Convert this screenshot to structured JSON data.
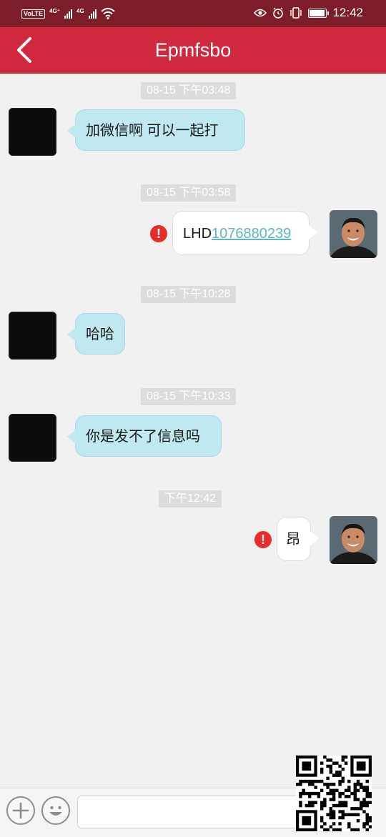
{
  "status_bar": {
    "volte": "VoLTE",
    "net1": "4G⁺",
    "net2": "4G",
    "time": "12:42"
  },
  "header": {
    "title": "Epmfsbo",
    "back_icon": "chevron-left-icon"
  },
  "messages": [
    {
      "time": "08-15 下午03:48",
      "direction": "in",
      "text": "加微信啊  可以一起打"
    },
    {
      "time": "08-15 下午03:58",
      "direction": "out",
      "text_prefix": "LHD",
      "link": "1076880239",
      "failed": true
    },
    {
      "time": "08-15 下午10:28",
      "direction": "in",
      "text": "哈哈"
    },
    {
      "time": "08-15 下午10:33",
      "direction": "in",
      "text": "你是发不了信息吗"
    },
    {
      "time": "下午12:42",
      "direction": "out",
      "text": "昂",
      "failed": true
    }
  ],
  "failed_mark": "!",
  "input_bar": {
    "add_icon": "plus-icon",
    "emoji_icon": "smiley-icon",
    "input_value": ""
  },
  "colors": {
    "header": "#d0283c",
    "status_bar": "#7e1d2a",
    "incoming_bubble": "#bfe8f0",
    "outgoing_bubble": "#ffffff",
    "link": "#5db8bf",
    "error": "#e82c2c"
  }
}
